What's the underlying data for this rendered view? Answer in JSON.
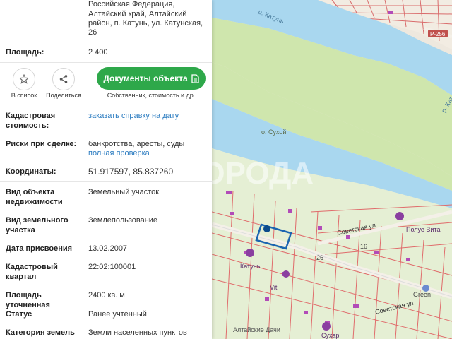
{
  "address": {
    "line1": "Российская Федерация,",
    "line2": "Алтайский край, Алтайский",
    "line3": "район, п. Катунь, ул. Катунская,",
    "line4": "26"
  },
  "area": {
    "label": "Площадь:",
    "value": "2 400"
  },
  "actions": {
    "favorite_label": "В список",
    "share_label": "Поделиться",
    "documents_button": "Документы объекта",
    "documents_sub": "Собственник, стоимость и др."
  },
  "cadastral_value": {
    "label_line1": "Кадастровая",
    "label_line2": "стоимость:",
    "link": "заказать справку на дату"
  },
  "risks": {
    "label": "Риски при сделке:",
    "value": "банкротства, аресты, суды",
    "link": "полная проверка"
  },
  "coords": {
    "label": "Координаты:",
    "value": "51.917597, 85.837260"
  },
  "details": [
    {
      "label1": "Вид объекта",
      "label2": "недвижимости",
      "value": "Земельный участок"
    },
    {
      "label1": "Вид земельного",
      "label2": "участка",
      "value": "Землепользование"
    },
    {
      "label1": "Дата присвоения",
      "label2": "",
      "value": "13.02.2007"
    },
    {
      "label1": "Кадастровый",
      "label2": "квартал",
      "value": "22:02:100001"
    },
    {
      "label1": "Площадь уточненная",
      "label2": "",
      "value": "2400 кв. м"
    },
    {
      "label1": "Статус",
      "label2": "",
      "value": "Ранее учтенный"
    },
    {
      "label1": "Категория земель",
      "label2": "",
      "value": "Земли населенных пунктов"
    }
  ],
  "map": {
    "watermark": "ГОРОДА",
    "labels": {
      "katun_river_top": "р. Катунь",
      "katun_river_right": "р. Кат",
      "sukhoy": "о. Сухой",
      "road": "Р-256",
      "sovetskaya1": "Советская ул",
      "sovetskaya2": "Советская ул",
      "katun_village": "Катунь",
      "vitamin": "Vit",
      "green": "Green",
      "sukhar": "Сухар",
      "dachi": "Алтайские Дачи",
      "poly_vita": "Полуе Вита",
      "num16": "16",
      "num26": "26"
    }
  }
}
